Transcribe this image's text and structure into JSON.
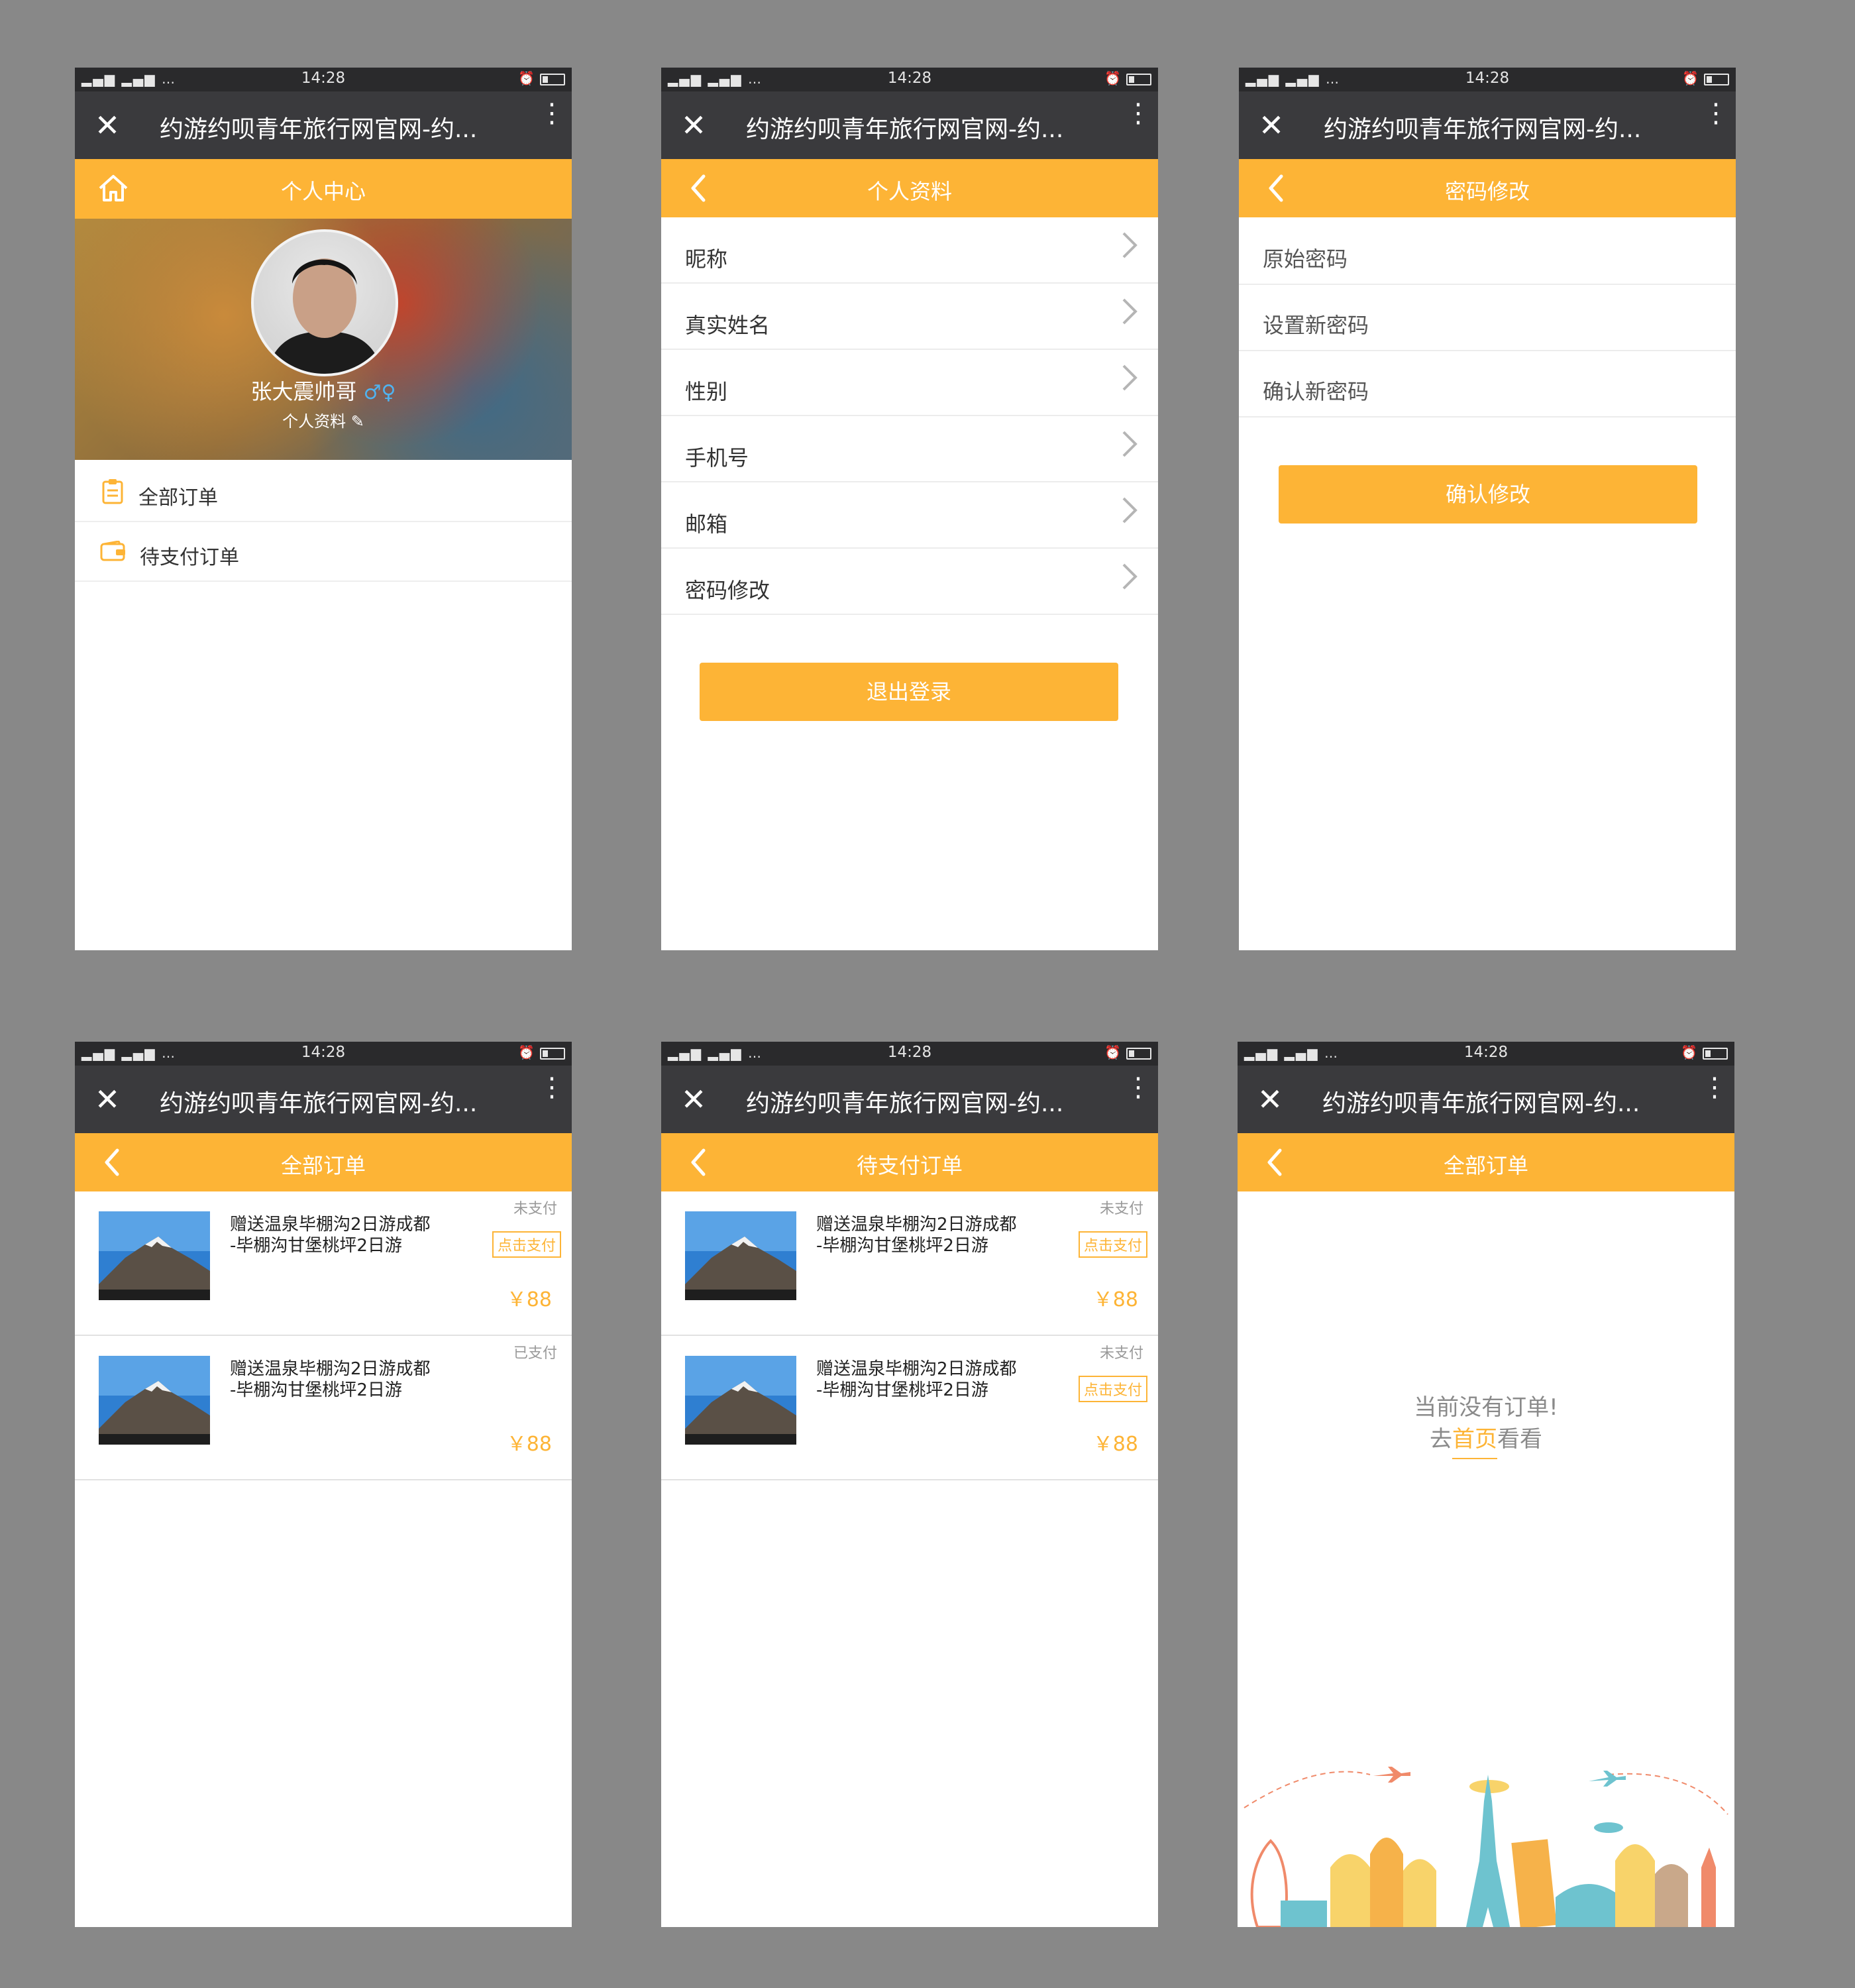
{
  "status_bar": {
    "time": "14:28",
    "signal": "▂▄▆ ▂▄▆ …",
    "alarm_icon": "⏰"
  },
  "browser": {
    "title": "约游约呗青年旅行网官网-约...",
    "close_glyph": "✕",
    "more_glyph": "⋮"
  },
  "colors": {
    "accent": "#fdb436",
    "topbar": "#3a3a3d",
    "statusbar": "#2a2a2c",
    "background": "#888888"
  },
  "screens": {
    "profile_center": {
      "title": "个人中心",
      "username": "张大震帅哥",
      "gender_icons": "♂♀",
      "profile_link": "个人资料",
      "menu": [
        {
          "label": "全部订单",
          "icon": "clipboard-icon"
        },
        {
          "label": "待支付订单",
          "icon": "wallet-icon"
        }
      ]
    },
    "personal_info": {
      "title": "个人资料",
      "items": [
        "昵称",
        "真实姓名",
        "性别",
        "手机号",
        "邮箱",
        "密码修改"
      ],
      "logout_label": "退出登录"
    },
    "password_change": {
      "title": "密码修改",
      "fields": [
        "原始密码",
        "设置新密码",
        "确认新密码"
      ],
      "confirm_label": "确认修改"
    },
    "all_orders": {
      "title": "全部订单",
      "orders": [
        {
          "line1": "赠送温泉毕棚沟2日游成都",
          "line2": "-毕棚沟甘堡桃坪2日游",
          "status": "未支付",
          "action": "点击支付",
          "price": "￥88"
        },
        {
          "line1": "赠送温泉毕棚沟2日游成都",
          "line2": "-毕棚沟甘堡桃坪2日游",
          "status": "已支付",
          "action": "",
          "price": "￥88"
        }
      ]
    },
    "pending_orders": {
      "title": "待支付订单",
      "orders": [
        {
          "line1": "赠送温泉毕棚沟2日游成都",
          "line2": "-毕棚沟甘堡桃坪2日游",
          "status": "未支付",
          "action": "点击支付",
          "price": "￥88"
        },
        {
          "line1": "赠送温泉毕棚沟2日游成都",
          "line2": "-毕棚沟甘堡桃坪2日游",
          "status": "未支付",
          "action": "点击支付",
          "price": "￥88"
        }
      ]
    },
    "empty_orders": {
      "title": "全部订单",
      "empty_text": "当前没有订单!",
      "goto_prefix": "去",
      "goto_link": "首页",
      "goto_suffix": "看看"
    }
  }
}
